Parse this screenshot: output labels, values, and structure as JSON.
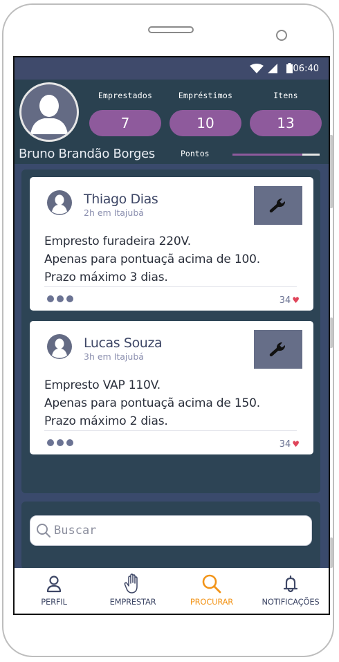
{
  "status_bar": {
    "time": "06:40"
  },
  "profile": {
    "name": "Bruno Brandão Borges",
    "stats": [
      {
        "label": "Emprestados",
        "value": "7"
      },
      {
        "label": "Empréstimos",
        "value": "10"
      },
      {
        "label": "Itens",
        "value": "13"
      }
    ],
    "points_label": "Pontos",
    "points_progress": 0.2
  },
  "feed": {
    "posts": [
      {
        "author": "Thiago Dias",
        "meta": "2h em Itajubá",
        "lines": [
          "Empresto furadeira 220V.",
          "Apenas para pontuaçã acima de 100.",
          "Prazo máximo 3 dias."
        ],
        "likes": "34",
        "tool_icon": "wrench-icon"
      },
      {
        "author": "Lucas Souza",
        "meta": "3h em Itajubá",
        "lines": [
          "Empresto VAP 110V.",
          "Apenas para pontuaçã acima de 150.",
          "Prazo máximo 2 dias."
        ],
        "likes": "34",
        "tool_icon": "wrench-icon"
      }
    ]
  },
  "search": {
    "placeholder": "Buscar",
    "value": ""
  },
  "tabbar": {
    "active": "PROCURAR",
    "active_color": "#f29418",
    "items": [
      {
        "label": "PERFIL",
        "icon": "user-icon"
      },
      {
        "label": "EMPRESTAR",
        "icon": "hand-icon"
      },
      {
        "label": "PROCURAR",
        "icon": "search-icon"
      },
      {
        "label": "NOTIFICAÇÕES",
        "icon": "bell-icon"
      }
    ]
  },
  "colors": {
    "accent_purple": "#8e5a9c",
    "header_bg": "#2a4150",
    "status_bar_bg": "#3f4a6b",
    "tool_tile": "#666e88",
    "heart": "#e0455a"
  }
}
